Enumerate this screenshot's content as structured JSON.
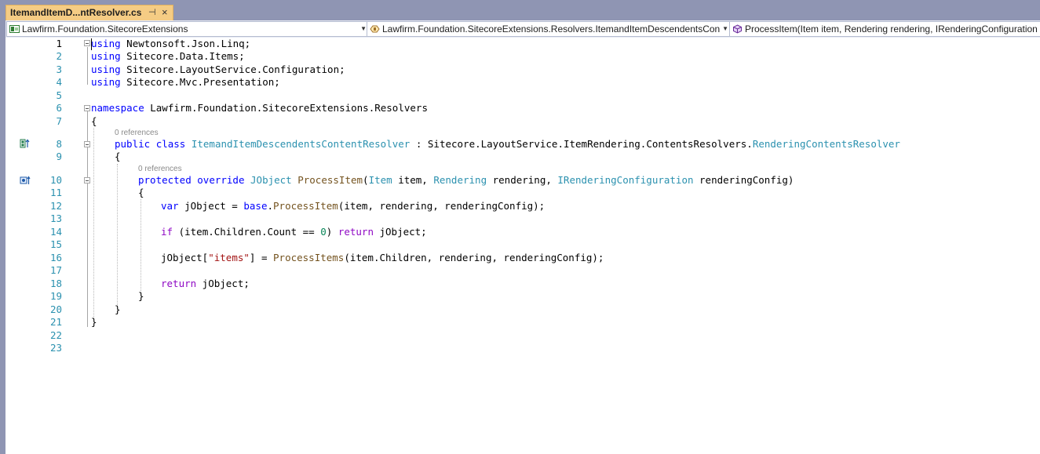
{
  "tab": {
    "title": "ItemandItemD...ntResolver.cs",
    "pin_glyph": "⊣",
    "close_glyph": "×"
  },
  "nav": {
    "project": "Lawfirm.Foundation.SitecoreExtensions",
    "type": "Lawfirm.Foundation.SitecoreExtensions.Resolvers.ItemandItemDescendentsCon",
    "member": "ProcessItem(Item item, Rendering rendering, IRenderingConfiguration r"
  },
  "code": {
    "line_numbers": [
      "1",
      "2",
      "3",
      "4",
      "5",
      "6",
      "7",
      "8",
      "9",
      "10",
      "11",
      "12",
      "13",
      "14",
      "15",
      "16",
      "17",
      "18",
      "19",
      "20",
      "21",
      "22",
      "23"
    ],
    "refs_label": "0 references",
    "l1": [
      "using",
      " Newtonsoft.Json.Linq;"
    ],
    "l2": [
      "using",
      " Sitecore.Data.Items;"
    ],
    "l3": [
      "using",
      " Sitecore.LayoutService.Configuration;"
    ],
    "l4": [
      "using",
      " Sitecore.Mvc.Presentation;"
    ],
    "l6": [
      "namespace",
      " Lawfirm.Foundation.SitecoreExtensions.Resolvers"
    ],
    "l7": "{",
    "l8": [
      "public",
      " ",
      "class",
      " ",
      "ItemandItemDescendentsContentResolver",
      " : Sitecore.LayoutService.ItemRendering.ContentsResolvers.",
      "RenderingContentsResolver"
    ],
    "l9": "{",
    "l10": [
      "protected",
      " ",
      "override",
      " ",
      "JObject",
      " ",
      "ProcessItem",
      "(",
      "Item",
      " item, ",
      "Rendering",
      " rendering, ",
      "IRenderingConfiguration",
      " renderingConfig)"
    ],
    "l11": "{",
    "l12": [
      "var",
      " jObject = ",
      "base",
      ".",
      "ProcessItem",
      "(item, rendering, renderingConfig);"
    ],
    "l14": [
      "if",
      " (item.Children.Count == ",
      "0",
      ") ",
      "return",
      " jObject;"
    ],
    "l16": [
      "jObject[",
      "\"items\"",
      "] = ",
      "ProcessItems",
      "(item.Children, rendering, renderingConfig);"
    ],
    "l18": [
      "return",
      " jObject;"
    ],
    "l19": "}",
    "l20": "}",
    "l21": "}"
  }
}
